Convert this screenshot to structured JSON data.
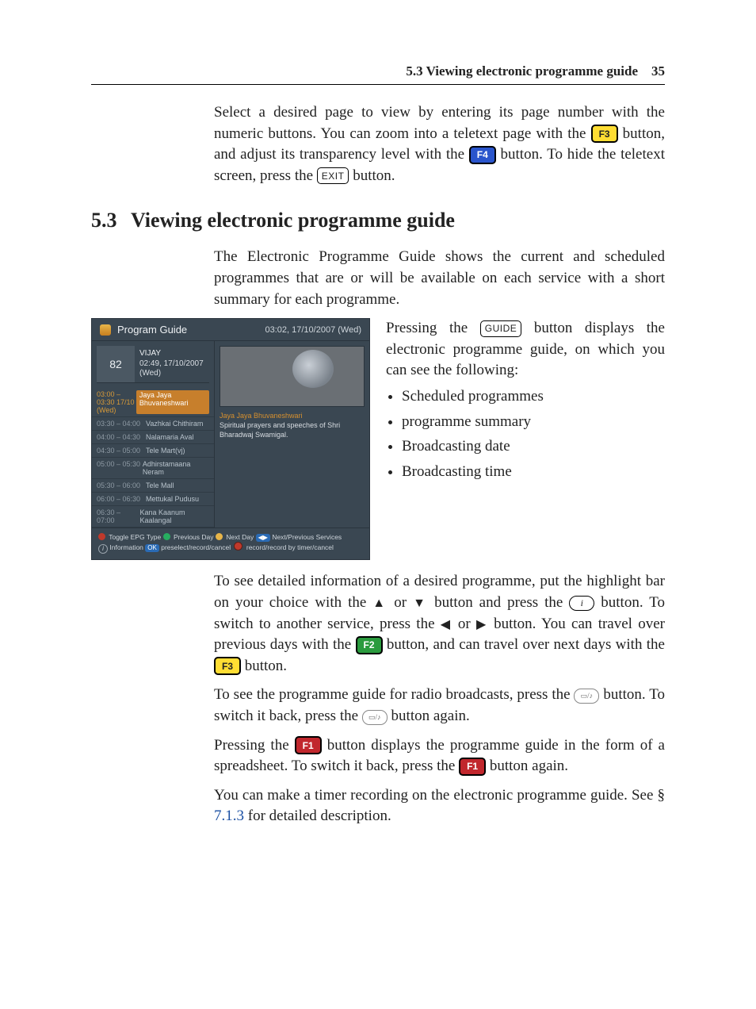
{
  "header": {
    "section_ref": "5.3 Viewing electronic programme guide",
    "page_num": "35"
  },
  "intro": {
    "p1a": "Select a desired page to view by entering its page number with the numeric buttons. You can zoom into a teletext page with the ",
    "f3": "F3",
    "p1b": " button, and adjust its transparency level with the ",
    "f4": "F4",
    "p1c": " button. To hide the teletext screen, press the ",
    "exit": "EXIT",
    "p1d": " button."
  },
  "section": {
    "num": "5.3",
    "title": "Viewing electronic programme guide"
  },
  "epg_intro": "The Electronic Programme Guide shows the current and scheduled programmes that are or will be available on each service with a short summary for each programme.",
  "right": {
    "p_a": "Pressing the ",
    "guide": "GUIDE",
    "p_b": " button displays the electronic programme guide, on which you can see the following:",
    "bullets": [
      "Scheduled programmes",
      "programme summary",
      "Broadcasting date",
      "Broadcasting time"
    ]
  },
  "epg": {
    "title": "Program Guide",
    "clock": "03:02, 17/10/2007 (Wed)",
    "ch_num": "82",
    "ch_name": "VIJAY",
    "ch_time": "02:49, 17/10/2007 (Wed)",
    "rows": [
      {
        "time": "03:00 – 03:30 17/10 (Wed)",
        "name": "Jaya Jaya Bhuvaneshwari",
        "sel": true
      },
      {
        "time": "03:30 – 04:00",
        "name": "Vazhkai Chithiram"
      },
      {
        "time": "04:00 – 04:30",
        "name": "Nalamaria Aval"
      },
      {
        "time": "04:30 – 05:00",
        "name": "Tele Mart(vj)"
      },
      {
        "time": "05:00 – 05:30",
        "name": "Adhirstamaana Neram"
      },
      {
        "time": "05:30 – 06:00",
        "name": "Tele Mall"
      },
      {
        "time": "06:00 – 06:30",
        "name": "Mettukal Pudusu"
      },
      {
        "time": "06:30 – 07:00",
        "name": "Kana Kaanum Kaalangal"
      }
    ],
    "summary_title": "Jaya Jaya Bhuvaneshwari",
    "summary_body": "Spiritual prayers and speeches of Shri Bharadwaj Swamigal.",
    "legend": {
      "toggle": "Toggle EPG Type",
      "prev": "Previous Day",
      "next": "Next Day",
      "np": "Next/Previous Services",
      "info": "Information",
      "ok": "OK",
      "ok_txt": "preselect/record/cancel",
      "rec": "record/record by timer/cancel"
    }
  },
  "body": {
    "p2a": "To see detailed information of a desired programme, put the highlight bar on your choice with the ",
    "up": "▲",
    "or1": " or ",
    "down": "▼",
    "p2b": " button and press the ",
    "i": "i",
    "p2c": " button. To switch to another service, press the ",
    "left": "◀",
    "or2": " or ",
    "right": "▶",
    "p2d": " button. You can travel over previous days with the ",
    "f2": "F2",
    "p2e": " button, and can travel over next days with the ",
    "f3": "F3",
    "p2f": " button.",
    "p3a": "To see the programme guide for radio broadcasts, press the ",
    "radio": "▭/♪",
    "p3b": " button. To switch it back, press the ",
    "p3c": " button again.",
    "p4a": "Pressing the ",
    "f1": "F1",
    "p4b": " button displays the programme guide in the form of a spreadsheet. To switch it back, press the ",
    "p4c": " button again.",
    "p5a": "You can make a timer recording on the electronic programme guide. See § ",
    "ref": "7.1.3",
    "p5b": " for detailed description."
  }
}
